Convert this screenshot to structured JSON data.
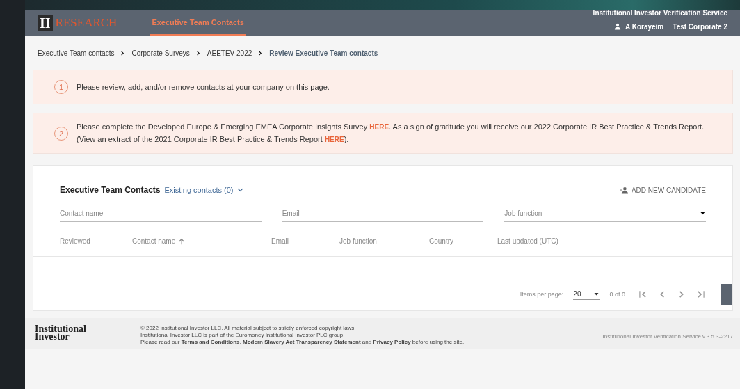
{
  "header": {
    "logo_mark": "II",
    "logo_text": "RESEARCH",
    "nav": [
      {
        "label": "Executive Team Contacts",
        "selected": true
      }
    ],
    "service_title": "Institutional Investor Verification Service",
    "user": "A Korayeim",
    "account": "Test Corporate 2"
  },
  "breadcrumbs": [
    {
      "label": "Executive Team contacts",
      "current": false
    },
    {
      "label": "Corporate Surveys",
      "current": false
    },
    {
      "label": "AEETEV 2022",
      "current": false
    },
    {
      "label": "Review Executive Team contacts",
      "current": true
    }
  ],
  "notices": [
    {
      "number": "1",
      "lines": [
        [
          {
            "kind": "text",
            "text": "Please review, add, and/or remove contacts at your company on this page."
          }
        ]
      ]
    },
    {
      "number": "2",
      "lines": [
        [
          {
            "kind": "text",
            "text": "Please complete the Developed Europe & Emerging EMEA Corporate Insights Survey "
          },
          {
            "kind": "link",
            "text": "HERE"
          },
          {
            "kind": "text",
            "text": ". As a sign of gratitude you will receive our 2022 Corporate IR Best Practice & Trends Report."
          }
        ],
        [
          {
            "kind": "text",
            "text": "(View an extract of the 2021 Corporate IR Best Practice & Trends Report "
          },
          {
            "kind": "link",
            "text": "HERE"
          },
          {
            "kind": "text",
            "text": ")."
          }
        ]
      ]
    }
  ],
  "contacts": {
    "title": "Executive Team Contacts",
    "existing": "Existing contacts (0)",
    "add_button": "ADD NEW CANDIDATE",
    "filters": [
      {
        "kind": "text",
        "placeholder": "Contact name"
      },
      {
        "kind": "text",
        "placeholder": "Email"
      },
      {
        "kind": "select",
        "placeholder": "Job function"
      }
    ],
    "columns": [
      {
        "label": "Reviewed",
        "sorted": false
      },
      {
        "label": "Contact name",
        "sorted": true
      },
      {
        "label": "Email",
        "sorted": false
      },
      {
        "label": "Job function",
        "sorted": false
      },
      {
        "label": "Country",
        "sorted": false
      },
      {
        "label": "Last updated (UTC)",
        "sorted": false
      }
    ],
    "paginator": {
      "label": "Items per page:",
      "page_size": "20",
      "range": "0 of 0"
    }
  },
  "footer": {
    "logo": [
      "Institutional",
      "Investor"
    ],
    "legal": [
      "© 2022 Institutional Investor LLC. All material subject to strictly enforced copyright laws.",
      "Institutional Investor LLC is part of the Euromoney Institutional Investor PLC group.",
      "Please read our **Terms and Conditions**, **Modern Slavery Act Transparency Statement** and **Privacy Policy** before using the site."
    ],
    "version": "Institutional Investor Verification Service v.3.5.3-2217"
  }
}
